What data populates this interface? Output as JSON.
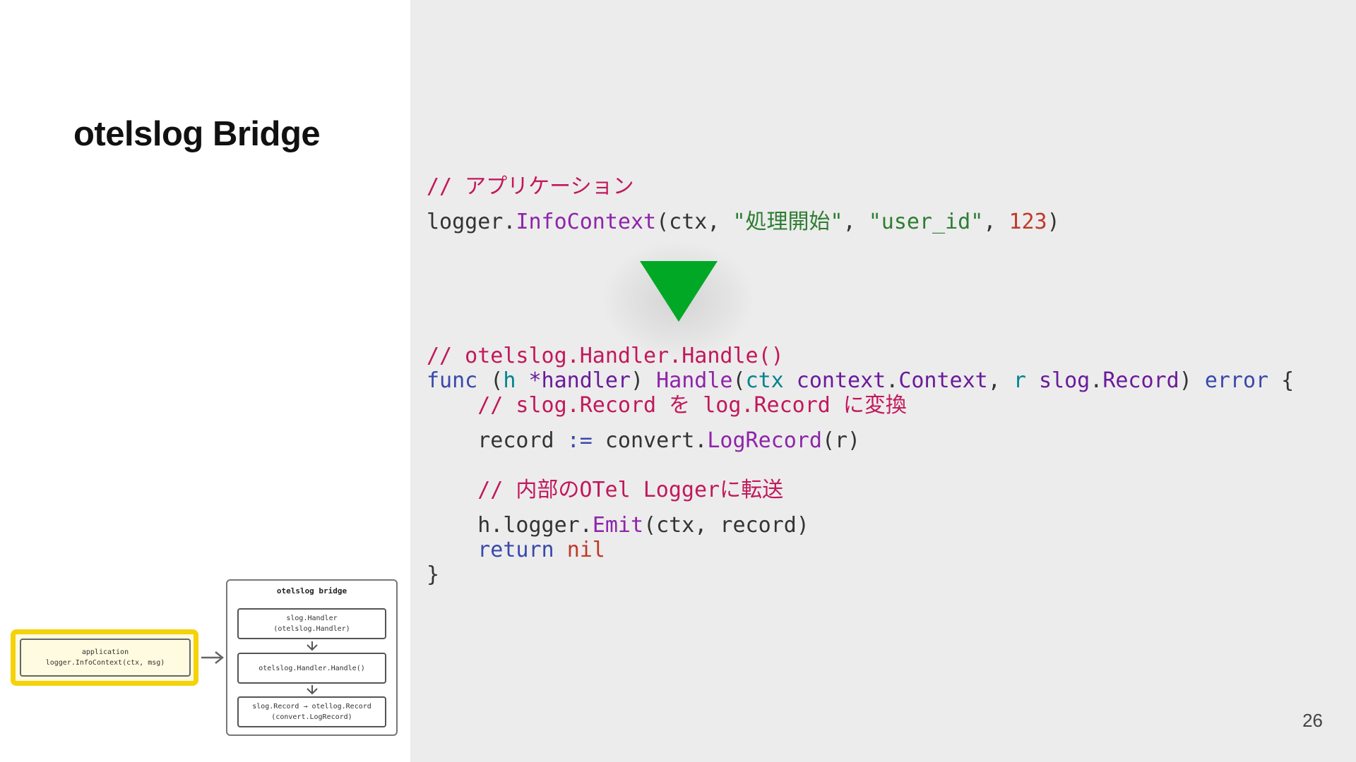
{
  "slide": {
    "title": "otelslog Bridge",
    "page_number": "26"
  },
  "code": {
    "app_comment": "// アプリケーション",
    "app_call": {
      "obj": "logger",
      "dot": ".",
      "method": "InfoContext",
      "open": "(ctx, ",
      "msg": "\"処理開始\"",
      "sep1": ", ",
      "key": "\"user_id\"",
      "sep2": ", ",
      "num": "123",
      "close": ")"
    },
    "handle_comment": "// otelslog.Handler.Handle()",
    "func_line": {
      "kw": "func",
      "p1": " (",
      "recv": "h",
      "recv_type": " *handler",
      "p2": ") ",
      "name": "Handle",
      "p3": "(",
      "ctx": "ctx",
      "ctx_type": " context",
      "dot1": ".",
      "ctx_type2": "Context",
      "p4": ", ",
      "r": "r",
      "r_type": " slog",
      "dot2": ".",
      "r_type2": "Record",
      "p5": ") ",
      "ret": "error",
      "p6": " {"
    },
    "convert_comment": "    // slog.Record を log.Record に変換",
    "record_line": {
      "indent": "    ",
      "var": "record ",
      "op": ":=",
      "obj": " convert",
      "dot": ".",
      "method": "LogRecord",
      "args": "(r)"
    },
    "forward_comment": "    // 内部のOTel Loggerに転送",
    "emit_line": {
      "indent": "    ",
      "obj": "h.logger",
      "dot": ".",
      "method": "Emit",
      "args": "(ctx, record)"
    },
    "return_line": {
      "indent": "    ",
      "kw": "return",
      "sp": " ",
      "val": "nil"
    },
    "close_brace": "}"
  },
  "diagram": {
    "app_line1": "application",
    "app_line2": "logger.InfoContext(ctx, msg)",
    "bridge_title": "otelslog bridge",
    "box1_line1": "slog.Handler",
    "box1_line2": "(otelslog.Handler)",
    "box2_line1": "otelslog.Handler.Handle()",
    "box3_line1": "slog.Record → otellog.Record",
    "box3_line2": "(convert.LogRecord)"
  },
  "colors": {
    "background_right": "#ececec",
    "arrow_green": "#00a825",
    "highlight_yellow": "#f5d20a",
    "comment": "#c2185b",
    "method": "#8e24aa",
    "string": "#2e7d32",
    "keyword": "#3949ab"
  },
  "icons": {
    "flow_arrow": "down-triangle-icon"
  }
}
